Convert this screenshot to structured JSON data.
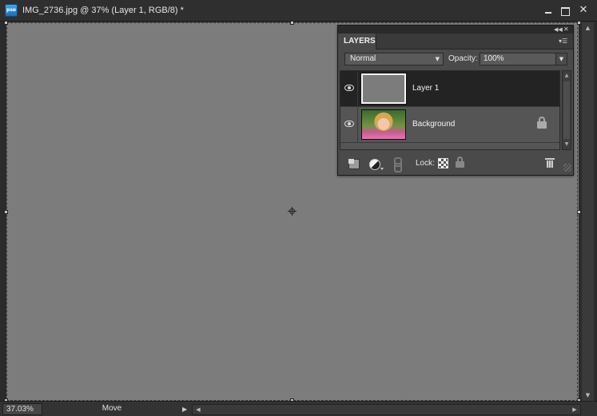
{
  "window": {
    "app_icon_text": "pse",
    "title": "IMG_2736.jpg @ 37% (Layer 1, RGB/8) *"
  },
  "layers_panel": {
    "tab_label": "LAYERS",
    "blend_mode": "Normal",
    "opacity_label": "Opacity:",
    "opacity_value": "100%",
    "layers": [
      {
        "name": "Layer 1",
        "selected": true,
        "visible": true,
        "locked": false
      },
      {
        "name": "Background",
        "selected": false,
        "visible": true,
        "locked": true
      }
    ],
    "lock_label": "Lock:"
  },
  "status": {
    "zoom": "37.03%",
    "tool": "Move"
  },
  "icons": {
    "visibility": "eye-icon",
    "lock": "lock-icon",
    "new_layer": "new-layer-icon",
    "adjustment": "adjustment-layer-icon",
    "link": "link-icon",
    "lock_transparent": "lock-transparent-icon",
    "lock_all": "lock-all-icon",
    "delete": "trash-icon"
  },
  "colors": {
    "canvas": "#7c7c7c",
    "panel": "#4a4a4a",
    "selected_row": "#232323"
  }
}
